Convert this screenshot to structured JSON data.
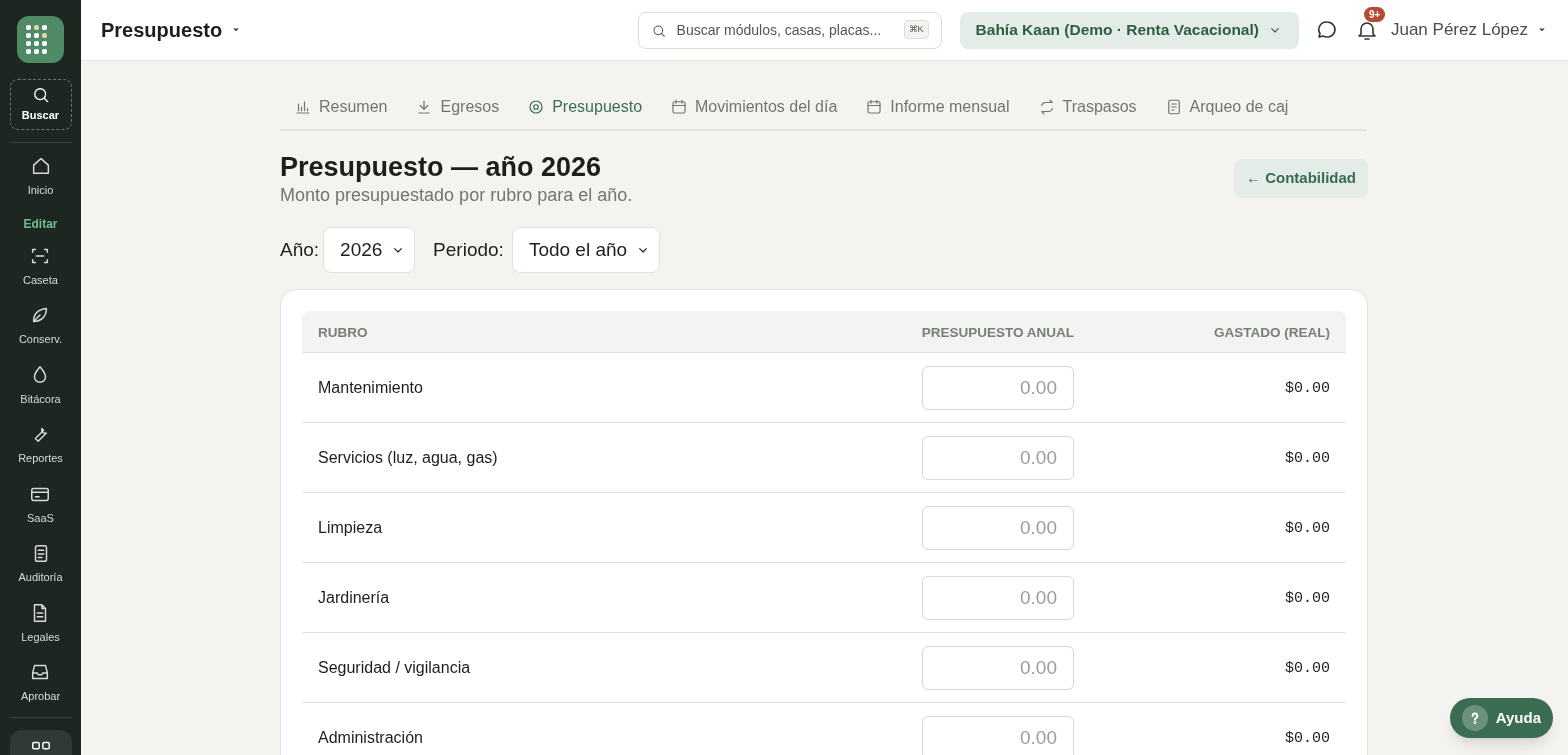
{
  "header": {
    "title": "Presupuesto",
    "search": {
      "placeholder": "Buscar módulos, casas, placas...",
      "shortcut": "⌘K"
    },
    "property": "Bahía Kaan (Demo · Renta Vacacional)",
    "notifications": "9+",
    "user": "Juan Pérez López"
  },
  "sidebar": {
    "search": "Buscar",
    "items": [
      {
        "kind": "item",
        "label": "Inicio"
      },
      {
        "kind": "section",
        "label": "Editar"
      },
      {
        "kind": "item",
        "label": "Caseta"
      },
      {
        "kind": "item",
        "label": "Conserv."
      },
      {
        "kind": "item",
        "label": "Bitácora"
      },
      {
        "kind": "item",
        "label": "Reportes"
      },
      {
        "kind": "item",
        "label": "SaaS"
      },
      {
        "kind": "item",
        "label": "Auditoría"
      },
      {
        "kind": "item",
        "label": "Legales"
      },
      {
        "kind": "item",
        "label": "Aprobar"
      }
    ]
  },
  "tabs": [
    {
      "label": "Resumen",
      "selected": false
    },
    {
      "label": "Egresos",
      "selected": false
    },
    {
      "label": "Presupuesto",
      "selected": true
    },
    {
      "label": "Movimientos del día",
      "selected": false
    },
    {
      "label": "Informe mensual",
      "selected": false
    },
    {
      "label": "Traspasos",
      "selected": false
    },
    {
      "label": "Arqueo de caj",
      "selected": false
    }
  ],
  "page": {
    "title": "Presupuesto — año 2026",
    "subtitle": "Monto presupuestado por rubro para el año.",
    "back_link": "← Contabilidad"
  },
  "filters": [
    {
      "label": "Año:",
      "value": "2026"
    },
    {
      "label": "Periodo:",
      "value": "Todo el año"
    }
  ],
  "table": {
    "columns": [
      "RUBRO",
      "PRESUPUESTO ANUAL",
      "GASTADO (REAL)"
    ],
    "rows": [
      {
        "rubro": "Mantenimiento",
        "placeholder": "0.00",
        "gastado": "$0.00"
      },
      {
        "rubro": "Servicios (luz, agua, gas)",
        "placeholder": "0.00",
        "gastado": "$0.00"
      },
      {
        "rubro": "Limpieza",
        "placeholder": "0.00",
        "gastado": "$0.00"
      },
      {
        "rubro": "Jardinería",
        "placeholder": "0.00",
        "gastado": "$0.00"
      },
      {
        "rubro": "Seguridad / vigilancia",
        "placeholder": "0.00",
        "gastado": "$0.00"
      },
      {
        "rubro": "Administración",
        "placeholder": "0.00",
        "gastado": "$0.00"
      }
    ]
  },
  "help_button": "Ayuda"
}
